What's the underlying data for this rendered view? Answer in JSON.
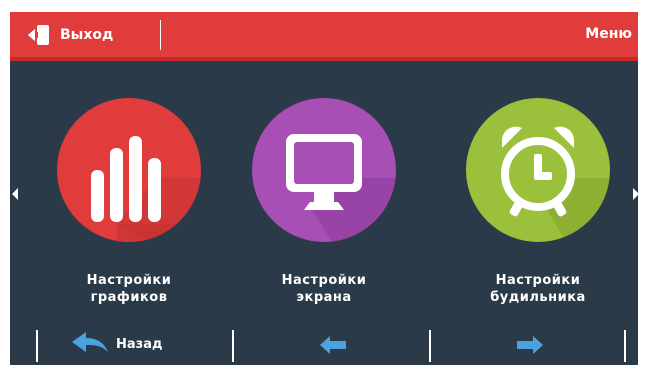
{
  "header": {
    "exit_label": "Выход",
    "menu_label": "Меню"
  },
  "tiles": [
    {
      "line1": "Настройки",
      "line2": "графиков",
      "icon": "bar-chart-icon",
      "color": "#e03c3c"
    },
    {
      "line1": "Настройки",
      "line2": "экрана",
      "icon": "monitor-icon",
      "color": "#a84fb5"
    },
    {
      "line1": "Настройки",
      "line2": "будильника",
      "icon": "alarm-clock-icon",
      "color": "#9bc03b"
    }
  ],
  "footer": {
    "back_label": "Назад"
  },
  "colors": {
    "background": "#2b3a48",
    "header": "#e03c3c",
    "accent_blue": "#4aa3df"
  }
}
